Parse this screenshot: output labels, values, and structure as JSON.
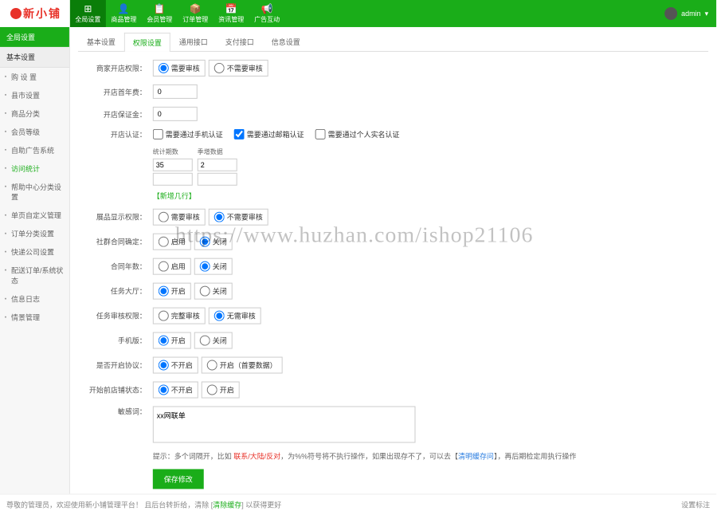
{
  "brand": {
    "text1": "新",
    "text2": "小",
    "text3": "铺"
  },
  "nav": [
    {
      "icon": "⊞",
      "label": "全局设置"
    },
    {
      "icon": "👤",
      "label": "商品管理"
    },
    {
      "icon": "📋",
      "label": "会员管理"
    },
    {
      "icon": "📦",
      "label": "订单管理"
    },
    {
      "icon": "📅",
      "label": "资讯管理"
    },
    {
      "icon": "📢",
      "label": "广告互动"
    }
  ],
  "user": {
    "name": "admin",
    "caret": "▾"
  },
  "sidebar": {
    "header": "全局设置",
    "sub": "基本设置",
    "items": [
      "购 设 置",
      "县市设置",
      "商品分类",
      "会员等级",
      "自助广告系统",
      "访问统计",
      "帮助中心分类设置",
      "单页自定义管理",
      "订单分类设置",
      "快递公司设置",
      "配送订单/系统状态",
      "信息日志",
      "情景管理"
    ],
    "activeIndex": 5
  },
  "tabs": [
    "基本设置",
    "权限设置",
    "通用接口",
    "支付接口",
    "信息设置"
  ],
  "activeTab": 1,
  "form": {
    "row_open": {
      "label": "商家开店权限：",
      "opt1": "需要审核",
      "opt2": "不需要审核"
    },
    "row_fee": {
      "label": "开店首年费：",
      "value": "0"
    },
    "row_deposit": {
      "label": "开店保证金：",
      "value": "0"
    },
    "row_auth": {
      "label": "开店认证：",
      "c1": "需要通过手机认证",
      "c2": "需要通过邮箱认证",
      "c3": "需要通过个人实名认证"
    },
    "nested": {
      "h1": "统计期数",
      "h2": "季增数据",
      "v1": "35",
      "v2": "2",
      "add": "【新增几行】"
    },
    "row_display": {
      "label": "展品显示权限：",
      "opt1": "需要审核",
      "opt2": "不需要审核"
    },
    "row_social": {
      "label": "社群合同确定：",
      "opt1": "启用",
      "opt2": "关闭"
    },
    "row_contract": {
      "label": "合同年数：",
      "opt1": "启用",
      "opt2": "关闭"
    },
    "row_hall": {
      "label": "任务大厅：",
      "opt1": "开启",
      "opt2": "关闭"
    },
    "row_reviewperm": {
      "label": "任务审核权限：",
      "opt1": "完整审核",
      "opt2": "无需审核"
    },
    "row_mobile": {
      "label": "手机版：",
      "opt1": "开启",
      "opt2": "关闭"
    },
    "row_protocol": {
      "label": "是否开启协议：",
      "opt1": "不开启",
      "opt2": "开启（首要数据）"
    },
    "row_ostatus": {
      "label": "开始前店铺状态：",
      "opt1": "不开启",
      "opt2": "开启"
    },
    "row_sensitive": {
      "label": "敏感词：",
      "value": "xx网联单"
    },
    "tip": {
      "pre": "提示：多个词隔开，比如 ",
      "r1": "联系/大陆/反对",
      "mid": "，为%%符号将不执行操作，如果出现存不了，可以去【",
      "b1": "清明缓存问",
      "tail": "】，再后期检定用执行操作"
    },
    "save": "保存修改"
  },
  "footer": {
    "left_a": "尊敬的管理员，欢迎使用新小铺管理平台！  且后台转折给，清除 [",
    "left_b": "清除缓存",
    "left_c": "]  以获得更好",
    "right": "设置标注"
  },
  "watermark": "https://www.huzhan.com/ishop21106"
}
